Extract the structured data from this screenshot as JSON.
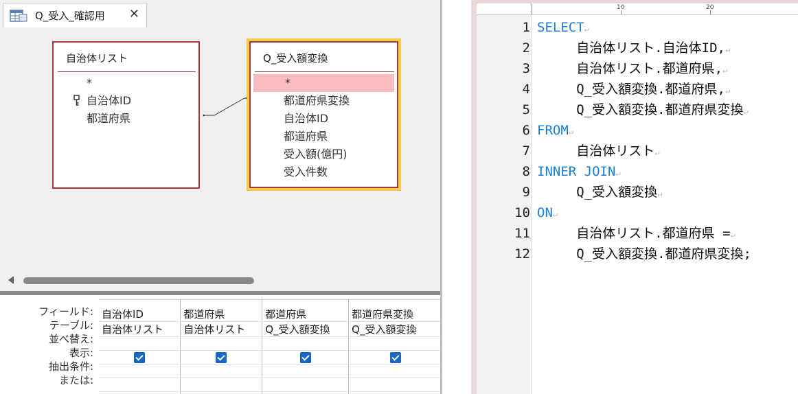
{
  "tab": {
    "title": "Q_受入_確認用",
    "close": "✕",
    "icon": "query-icon"
  },
  "tables": [
    {
      "title": "自治体リスト",
      "fields": [
        "*",
        "自治体ID",
        "都道府県"
      ]
    },
    {
      "title": "Q_受入額変換",
      "fields": [
        "*",
        "都道府県変換",
        "自治体ID",
        "都道府県",
        "受入額(億円)",
        "受入件数"
      ]
    }
  ],
  "grid": {
    "row_labels": [
      "フィールド:",
      "テーブル:",
      "並べ替え:",
      "表示:",
      "抽出条件:",
      "または:"
    ],
    "columns": [
      {
        "field": "自治体ID",
        "table": "自治体リスト",
        "show": true
      },
      {
        "field": "都道府県",
        "table": "自治体リスト",
        "show": true
      },
      {
        "field": "都道府県",
        "table": "Q_受入額変換",
        "show": true
      },
      {
        "field": "都道府県変換",
        "table": "Q_受入額変換",
        "show": true
      }
    ]
  },
  "ruler": {
    "marks": [
      "10",
      "20"
    ]
  },
  "sql": {
    "lines": [
      {
        "n": "1",
        "kw": "SELECT",
        "text": ""
      },
      {
        "n": "2",
        "kw": "",
        "text": "     自治体リスト.自治体ID,"
      },
      {
        "n": "3",
        "kw": "",
        "text": "     自治体リスト.都道府県,"
      },
      {
        "n": "4",
        "kw": "",
        "text": "     Q_受入額変換.都道府県,"
      },
      {
        "n": "5",
        "kw": "",
        "text": "     Q_受入額変換.都道府県変換"
      },
      {
        "n": "6",
        "kw": "FROM",
        "text": ""
      },
      {
        "n": "7",
        "kw": "",
        "text": "     自治体リスト"
      },
      {
        "n": "8",
        "kw": "INNER JOIN",
        "text": ""
      },
      {
        "n": "9",
        "kw": "",
        "text": "     Q_受入額変換"
      },
      {
        "n": "10",
        "kw": "ON",
        "text": ""
      },
      {
        "n": "11",
        "kw": "",
        "text": "     自治体リスト.都道府県 ="
      },
      {
        "n": "12",
        "kw": "",
        "text": "     Q_受入額変換.都道府県変換;"
      }
    ],
    "return_mark": "↵"
  },
  "colors": {
    "table_border": "#a43a3a",
    "selected_table": "#f6c94a",
    "selected_field": "#fbbcc1",
    "sql_keyword": "#1a7fd9",
    "checkbox": "#1668c4"
  }
}
